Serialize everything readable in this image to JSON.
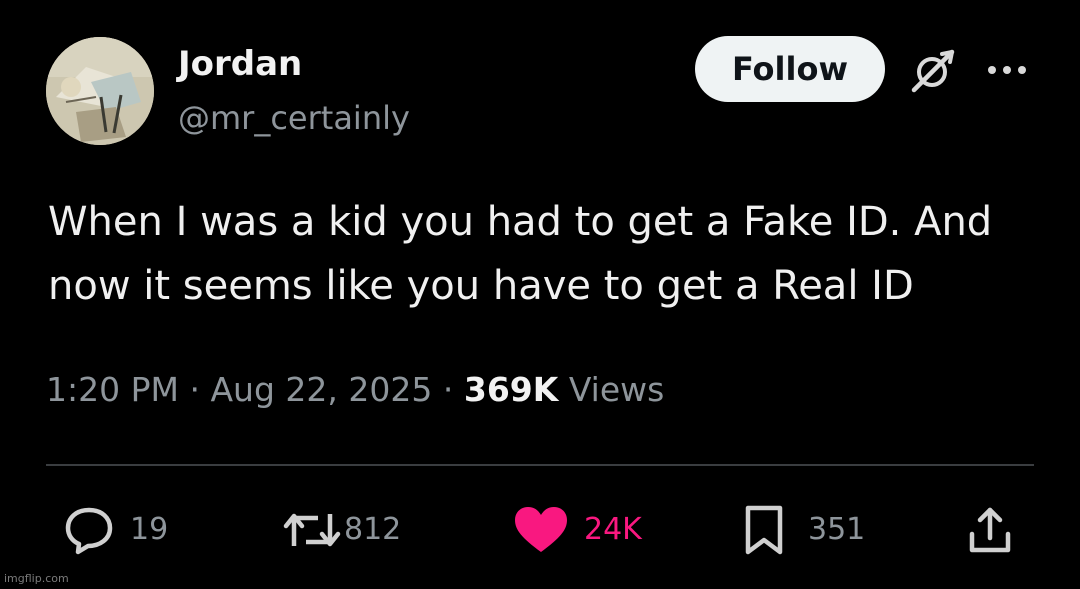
{
  "author": {
    "display_name": "Jordan",
    "handle": "@mr_certainly"
  },
  "follow_button_label": "Follow",
  "tweet_text": "When I was a kid you had to get a Fake ID. And now it seems like you have to get a Real ID",
  "meta": {
    "time": "1:20 PM",
    "separator": "·",
    "date": "Aug 22, 2025",
    "views_count": "369K",
    "views_label": "Views"
  },
  "actions": {
    "replies": "19",
    "reposts": "812",
    "likes": "24K",
    "bookmarks": "351"
  },
  "icons": {
    "avatar": "avatar",
    "grok": "grok-icon",
    "more": "more-icon",
    "reply": "reply-icon",
    "repost": "repost-icon",
    "like": "heart-icon",
    "bookmark": "bookmark-icon",
    "share": "share-icon"
  },
  "colors": {
    "background": "#000000",
    "text_primary": "#e7e9ea",
    "text_secondary": "#8e959b",
    "like_active": "#f91880",
    "follow_bg": "#eff3f4"
  },
  "watermark": "imgflip.com"
}
